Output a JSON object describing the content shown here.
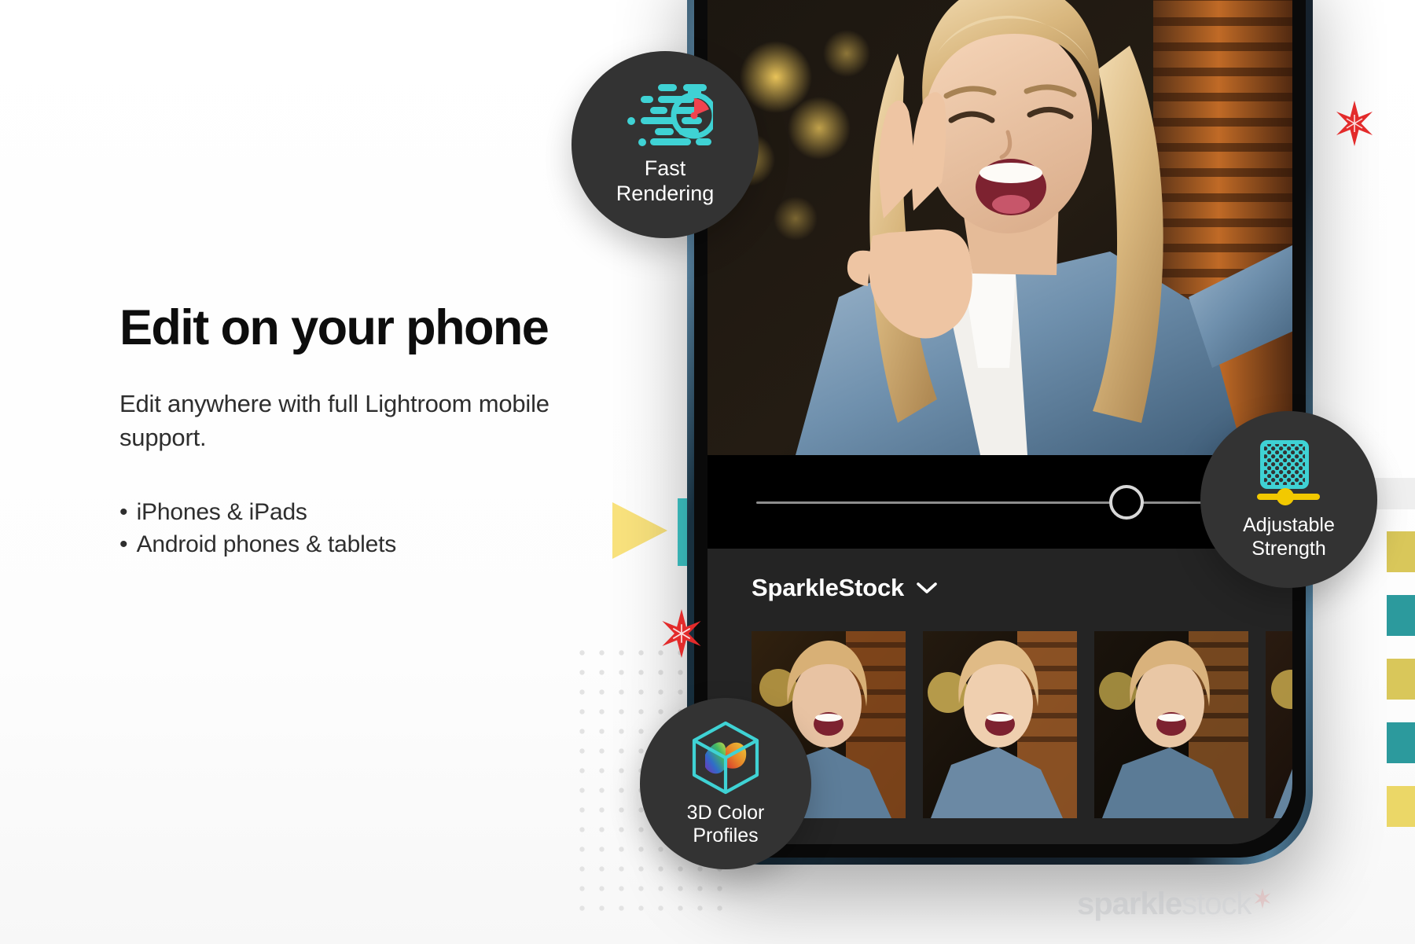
{
  "page": {
    "background_color": "#ffffff",
    "accent_teal": "#3FC9CB",
    "accent_yellow": "#F5D24A",
    "accent_red": "#E32B2B",
    "badge_bg": "#333333"
  },
  "copy": {
    "headline": "Edit on your phone",
    "subcopy": "Edit anywhere with full Lightroom mobile support.",
    "bullets": [
      {
        "marker": "•",
        "text": "iPhones & iPads"
      },
      {
        "marker": "•",
        "text": "Android phones & tablets"
      }
    ]
  },
  "badges": [
    {
      "id": "fast-rendering",
      "icon": "speed-stopwatch-icon",
      "line1": "Fast",
      "line2": "Rendering"
    },
    {
      "id": "adjustable-strength",
      "icon": "halftone-slider-icon",
      "line1": "Adjustable",
      "line2": "Strength"
    },
    {
      "id": "3d-color-profiles",
      "icon": "color-cube-icon",
      "line1": "3D Color",
      "line2": "Profiles"
    }
  ],
  "phone_app": {
    "slider": {
      "name": "strength-slider",
      "value_percent": 72
    },
    "preset_group": {
      "title": "SparkleStock",
      "chevron": "chevron-down-icon"
    },
    "thumbnails": [
      {
        "label": "preset-thumbnail-1"
      },
      {
        "label": "preset-thumbnail-2"
      },
      {
        "label": "preset-thumbnail-3"
      },
      {
        "label": "preset-thumbnail-4"
      }
    ]
  },
  "watermark": {
    "bold": "sparkle",
    "thin": "stock",
    "star": "star-icon"
  }
}
